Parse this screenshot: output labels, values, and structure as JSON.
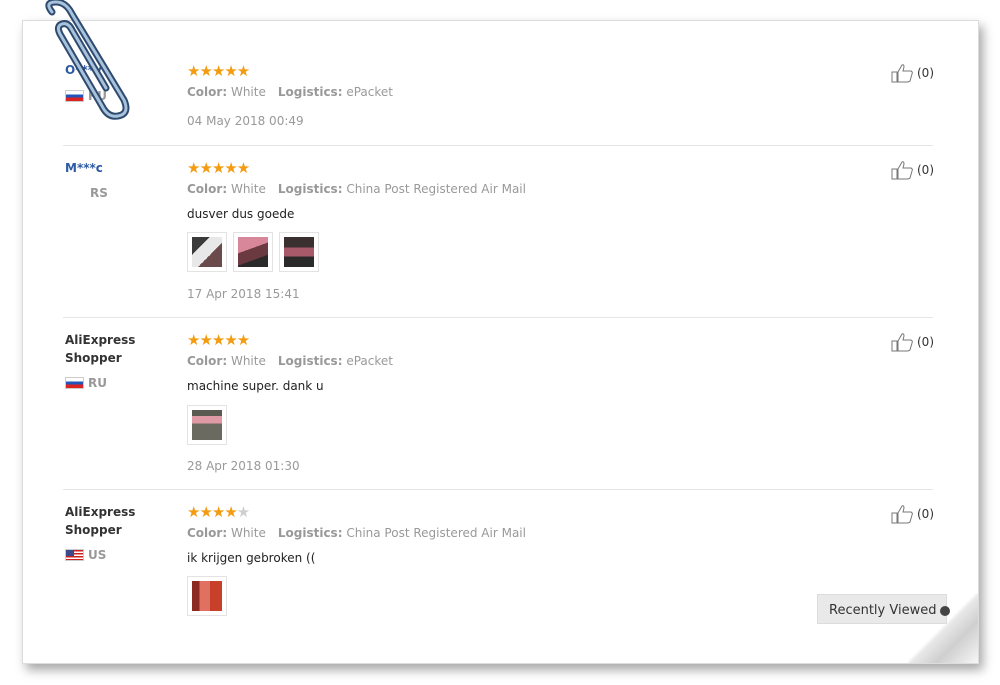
{
  "reviews": [
    {
      "name": "O***v",
      "country": "RU",
      "flag": "ru",
      "rating": 5,
      "stars_display": "★★★★★",
      "stars_off": "",
      "color_label": "Color:",
      "color_value": "White",
      "logistics_label": "Logistics:",
      "logistics_value": "ePacket",
      "comment": "",
      "date": "04 May 2018 00:49",
      "helpful_count": "(0)"
    },
    {
      "name": "M***c",
      "country": "RS",
      "flag": "",
      "rating": 5,
      "stars_display": "★★★★★",
      "stars_off": "",
      "color_label": "Color:",
      "color_value": "White",
      "logistics_label": "Logistics:",
      "logistics_value": "China Post Registered Air Mail",
      "comment": "dusver dus goede",
      "date": "17 Apr 2018 15:41",
      "helpful_count": "(0)"
    },
    {
      "name": "AliExpress Shopper",
      "country": "RU",
      "flag": "ru",
      "rating": 5,
      "stars_display": "★★★★★",
      "stars_off": "",
      "color_label": "Color:",
      "color_value": "White",
      "logistics_label": "Logistics:",
      "logistics_value": "ePacket",
      "comment": "machine super. dank u",
      "date": "28 Apr 2018 01:30",
      "helpful_count": "(0)"
    },
    {
      "name": "AliExpress Shopper",
      "country": "US",
      "flag": "us",
      "rating": 4,
      "stars_display": "★★★★",
      "stars_off": "★",
      "color_label": "Color:",
      "color_value": "White",
      "logistics_label": "Logistics:",
      "logistics_value": "China Post Registered Air Mail",
      "comment": "ik krijgen gebroken ((",
      "date": "",
      "helpful_count": "(0)"
    }
  ],
  "recently_viewed": "Recently Viewed",
  "icons": {
    "paperclip": "paperclip-icon",
    "thumbs_up": "thumbs-up-icon",
    "star": "star-icon"
  },
  "colors": {
    "star": "#f39c12",
    "link": "#2b5aa3",
    "muted": "#999999"
  }
}
